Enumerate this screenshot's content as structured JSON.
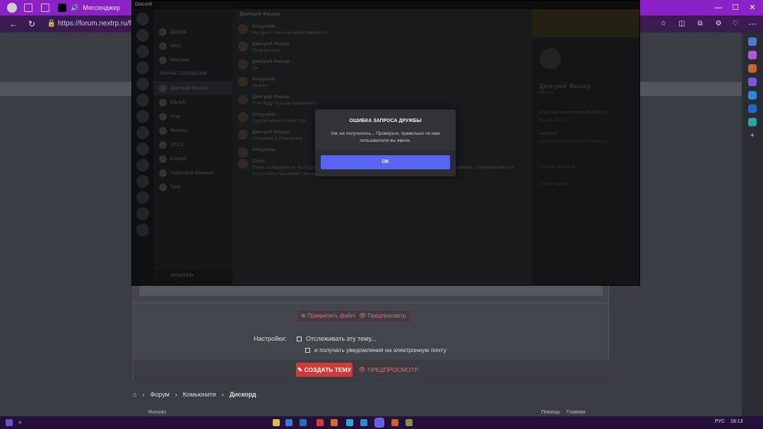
{
  "browser": {
    "tab_label": "Мессенджер",
    "url": "https://forum.nextrp.ru/foru",
    "win_controls": {
      "min": "—",
      "max": "☐",
      "close": "✕"
    }
  },
  "discord": {
    "title": "Discord",
    "chat_header": "Дмитрий Фишер",
    "dms": [
      {
        "label": "Друзья"
      },
      {
        "label": "Nitro"
      },
      {
        "label": "Магазин"
      },
      {
        "label": "ЛИЧНЫЕ СООБЩЕНИЯ"
      },
      {
        "label": "Дмитрий Фишер"
      },
      {
        "label": "Danich"
      },
      {
        "label": "Irina"
      },
      {
        "label": "Reimon"
      },
      {
        "label": "XXXX"
      },
      {
        "label": "Сергей"
      },
      {
        "label": "Горилла в Бизнесе"
      },
      {
        "label": "Гуля"
      }
    ],
    "user_name": "Amyyadda",
    "messages": [
      {
        "author": "Amyyadda",
        "text": "Не одного чела не представляется"
      },
      {
        "author": "Дмитрий Фишер",
        "text": "Понравилось"
      },
      {
        "author": "Дмитрий Фишер",
        "text": "Ок"
      },
      {
        "author": "Amyyadda",
        "text": "Звонки"
      },
      {
        "author": "Дмитрий Фишер",
        "text": "Я не буду больше продолжать"
      },
      {
        "author": "Amyyadda",
        "text": "Сделай играю в некст рп"
      },
      {
        "author": "Дмитрий Фишер",
        "text": "Отправлю в блокировку"
      },
      {
        "author": "Amyyadda",
        "text": ""
      },
      {
        "author": "Clyde",
        "text": "Ваше сообщение не было доставлено. Обычно такое случается, потому что у вас нет общих серверов с получателем или получатель принимает личные сообщения только от друзей."
      }
    ],
    "profile": {
      "name": "Дмитрий Фишер",
      "tag": "dfishers",
      "since_label": "В ЧИСЛЕ УЧАСТНИКОВ DISCORD С",
      "since": "09 дек. 2019 г.",
      "note_label": "ЗАМЕТКА",
      "note": "Нажмите, чтобы добавить заметку",
      "mutual_servers": "5 общих серверов",
      "mutual_friends": "2 общих друга"
    }
  },
  "modal": {
    "title": "ОШИБКА ЗАПРОСА ДРУЖБЫ",
    "body": "Хм, не получилось... Проверьте, правильно ли имя пользователя вы ввели.",
    "ok": "ОК"
  },
  "forum": {
    "attach_label": "Прикрепить файлы",
    "preview_label": "Предпросмотр",
    "settings_label": "Настройки:",
    "watch_label": "Отслеживать эту тему...",
    "email_label": "и получать уведомления на электронную почту",
    "create_label": "СОЗДАТЬ ТЕМУ",
    "preview2_label": "ПРЕДПРОСМОТР",
    "breadcrumb": [
      "Форум",
      "Комьюнити",
      "Дискорд"
    ],
    "footer_left": "Russian",
    "footer_right": [
      "Помощь",
      "Главная"
    ]
  },
  "taskbar": {
    "lang": "РУС",
    "time": "18:13"
  },
  "colors": {
    "accent": "#8a22c8",
    "discord_blurple": "#5865f2",
    "create_red": "#d23a3a"
  }
}
